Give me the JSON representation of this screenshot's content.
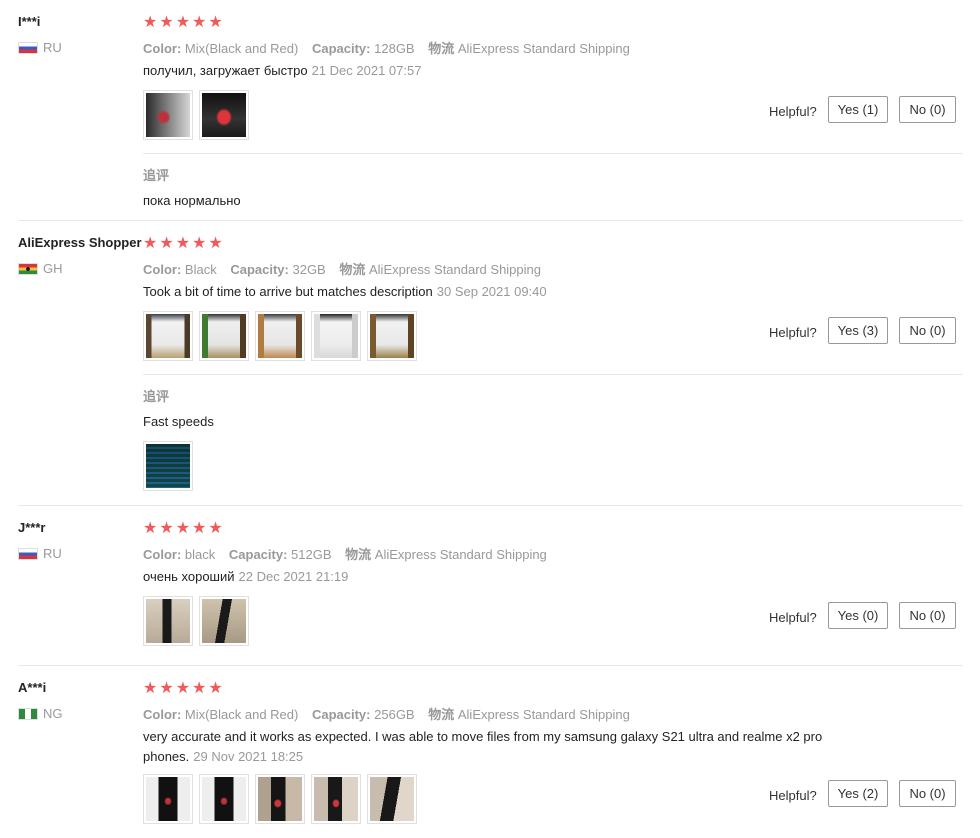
{
  "stars_glyph": "★",
  "helpful_label": "Helpful?",
  "reviews": [
    {
      "user": "I***i",
      "country": "RU",
      "color_key": "Color:",
      "color": "Mix(Black and Red)",
      "capacity_key": "Capacity:",
      "capacity": "128GB",
      "shipping_key": "物流",
      "shipping": "AliExpress Standard Shipping",
      "text": "получил, загружает быстро",
      "date": "21 Dec 2021 07:57",
      "yes": "Yes (1)",
      "no": "No (0)",
      "additional_label": "追评",
      "additional_text": "пока нормально"
    },
    {
      "user": "AliExpress Shopper",
      "country": "GH",
      "color_key": "Color:",
      "color": "Black",
      "capacity_key": "Capacity:",
      "capacity": "32GB",
      "shipping_key": "物流",
      "shipping": "AliExpress Standard Shipping",
      "text": "Took a bit of time to arrive but matches description",
      "date": "30 Sep 2021 09:40",
      "yes": "Yes (3)",
      "no": "No (0)",
      "additional_label": "追评",
      "additional_text": "Fast speeds"
    },
    {
      "user": "J***r",
      "country": "RU",
      "color_key": "Color:",
      "color": "black",
      "capacity_key": "Capacity:",
      "capacity": "512GB",
      "shipping_key": "物流",
      "shipping": "AliExpress Standard Shipping",
      "text": "очень хороший",
      "date": "22 Dec 2021 21:19",
      "yes": "Yes (0)",
      "no": "No (0)"
    },
    {
      "user": "A***i",
      "country": "NG",
      "color_key": "Color:",
      "color": "Mix(Black and Red)",
      "capacity_key": "Capacity:",
      "capacity": "256GB",
      "shipping_key": "物流",
      "shipping": "AliExpress Standard Shipping",
      "text": "very accurate and it works as expected. I was able to move files from my samsung galaxy S21 ultra and realme x2 pro phones.",
      "date": "29 Nov 2021 18:25",
      "yes": "Yes (2)",
      "no": "No (0)"
    }
  ],
  "colors": {
    "star": "#f05a5a",
    "muted": "#999999"
  }
}
